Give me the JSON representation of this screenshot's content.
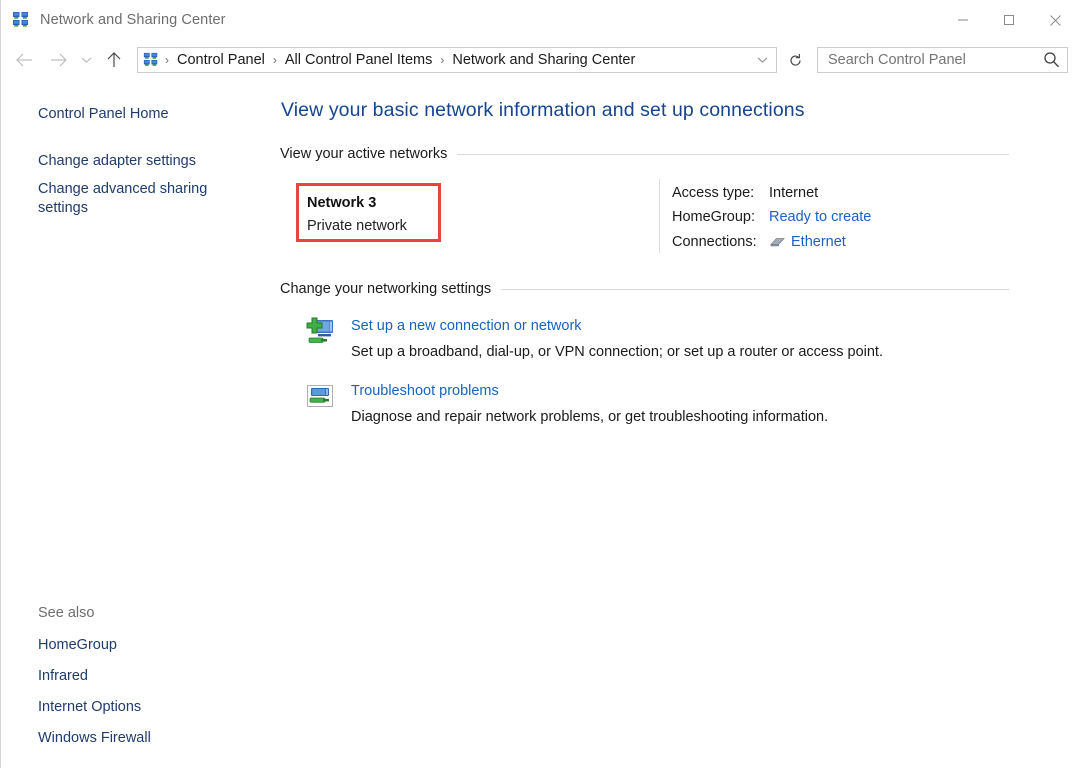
{
  "window": {
    "title": "Network and Sharing Center",
    "title_icon": "network-icon",
    "controls": {
      "minimize": "minimize-button",
      "maximize": "maximize-button",
      "close": "close-button"
    }
  },
  "navigation": {
    "back": "back-arrow-icon",
    "forward": "forward-arrow-icon",
    "recent": "chevron-down-icon",
    "up": "up-arrow-icon",
    "refresh": "refresh-icon",
    "breadcrumb_icon": "network-icon",
    "breadcrumb": [
      "Control Panel",
      "All Control Panel Items",
      "Network and Sharing Center"
    ],
    "breadcrumb_separator": "›",
    "breadcrumb_dropdown": "chevron-down-icon"
  },
  "search": {
    "placeholder": "Search Control Panel",
    "value": "",
    "icon": "search-icon"
  },
  "sidebar": {
    "home": "Control Panel Home",
    "items": [
      {
        "label": "Change adapter settings"
      },
      {
        "label": "Change advanced sharing settings"
      }
    ],
    "see_also": {
      "title": "See also",
      "items": [
        {
          "label": "HomeGroup"
        },
        {
          "label": "Infrared"
        },
        {
          "label": "Internet Options"
        },
        {
          "label": "Windows Firewall"
        }
      ]
    }
  },
  "main": {
    "page_title": "View your basic network information and set up connections",
    "active_networks": {
      "section_label": "View your active networks",
      "network": {
        "name": "Network  3",
        "type": "Private network",
        "highlight_color": "#e8453c"
      },
      "details": [
        {
          "key": "Access type:",
          "value": "Internet",
          "is_link": false
        },
        {
          "key": "HomeGroup:",
          "value": "Ready to create",
          "is_link": true
        },
        {
          "key": "Connections:",
          "value": "Ethernet",
          "is_link": true,
          "icon": "ethernet-icon"
        }
      ]
    },
    "networking_settings": {
      "section_label": "Change your networking settings",
      "items": [
        {
          "icon": "new-connection-icon",
          "link": "Set up a new connection or network",
          "description": "Set up a broadband, dial-up, or VPN connection; or set up a router or access point."
        },
        {
          "icon": "troubleshoot-icon",
          "link": "Troubleshoot problems",
          "description": "Diagnose and repair network problems, or get troubleshooting information."
        }
      ]
    }
  },
  "colors": {
    "title_blue": "#15458f",
    "link_blue": "#1962c4",
    "sidebar_link": "#1f3c6e",
    "highlight_red": "#e8453c"
  }
}
